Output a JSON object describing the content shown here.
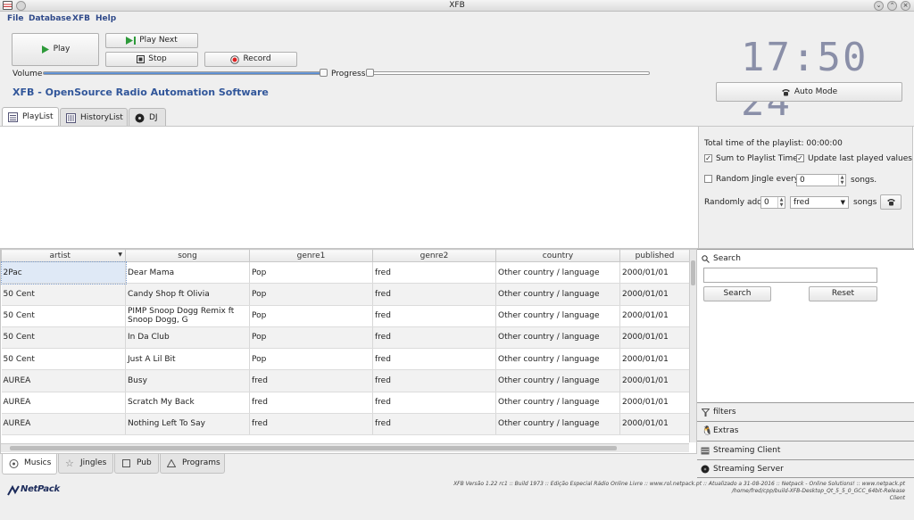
{
  "window": {
    "title": "XFB"
  },
  "menubar": {
    "items": [
      "File",
      "Database",
      "XFB",
      "Help"
    ]
  },
  "controls": {
    "play": "Play",
    "play_next": "Play Next",
    "stop": "Stop",
    "record": "Record",
    "volume_label": "Volume",
    "progress_label": "Progress",
    "volume_level": 1.0,
    "progress_level": 0.0
  },
  "app_title": "XFB - OpenSource Radio Automation Software",
  "clock": {
    "time": "17:50 24"
  },
  "auto_mode": "Auto Mode",
  "tabs": [
    "PlayList",
    "HistoryList",
    "DJ"
  ],
  "playlist_options": {
    "total_time": "Total time of the playlist: 00:00:00",
    "sum_label": "Sum to Playlist Time",
    "sum_checked": true,
    "update_label": "Update last played values",
    "update_checked": true,
    "jingle_label": "Random Jingle every:",
    "jingle_checked": false,
    "jingle_value": "0",
    "songs_label": "songs.",
    "randomly_add_label": "Randomly add:",
    "randomly_add_value": "0",
    "randomly_add_user": "fred",
    "randomly_songs_label": "songs"
  },
  "table": {
    "columns": [
      "artist",
      "song",
      "genre1",
      "genre2",
      "country",
      "published"
    ],
    "rows": [
      [
        "2Pac",
        "Dear Mama",
        "Pop",
        "fred",
        "Other country / language",
        "2000/01/01"
      ],
      [
        "50 Cent",
        "Candy Shop ft Olivia",
        "Pop",
        "fred",
        "Other country / language",
        "2000/01/01"
      ],
      [
        "50 Cent",
        "PIMP Snoop Dogg Remix ft Snoop Dogg, G",
        "Pop",
        "fred",
        "Other country / language",
        "2000/01/01"
      ],
      [
        "50 Cent",
        "In Da Club",
        "Pop",
        "fred",
        "Other country / language",
        "2000/01/01"
      ],
      [
        "50 Cent",
        "Just A Lil Bit",
        "Pop",
        "fred",
        "Other country / language",
        "2000/01/01"
      ],
      [
        "AUREA",
        "Busy",
        "fred",
        "fred",
        "Other country / language",
        "2000/01/01"
      ],
      [
        "AUREA",
        "Scratch My Back",
        "fred",
        "fred",
        "Other country / language",
        "2000/01/01"
      ],
      [
        "AUREA",
        "Nothing Left To Say",
        "fred",
        "fred",
        "Other country / language",
        "2000/01/01"
      ]
    ]
  },
  "search": {
    "header": "Search",
    "search_button": "Search",
    "reset_button": "Reset",
    "query": ""
  },
  "sidebar_sections": [
    "filters",
    "Extras",
    "Streaming Client",
    "Streaming Server"
  ],
  "bottom_tabs": [
    "Musics",
    "Jingles",
    "Pub",
    "Programs"
  ],
  "footer": {
    "logo_text": "NetPack",
    "line1": "XFB Versão 1.22 rc1 :: Build 1973 :: Edição Especial Rádio Online Livre :: www.rol.netpack.pt :: Atualizado a 31-08-2016 :: Netpack - Online Solutions! :: www.netpack.pt",
    "line2": "/home/fred/cpp/build-XFB-Desktop_Qt_5_5_0_GCC_64bit-Release",
    "line3": "Client"
  }
}
